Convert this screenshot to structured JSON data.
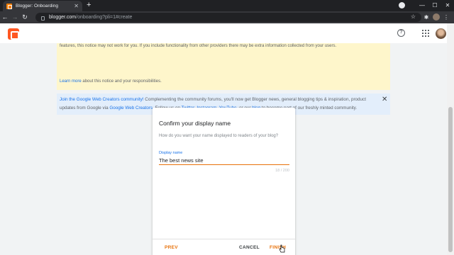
{
  "browser": {
    "tab_title": "Blogger: Onboarding",
    "tab_close": "✕",
    "new_tab": "+",
    "window_controls": [
      "—",
      "☐",
      "✕"
    ],
    "url_host": "blogger.com",
    "url_path": "/onboarding?pli=1#create",
    "nav_back": "←",
    "nav_forward": "→",
    "nav_reload": "↻",
    "bookmark_star": "☆",
    "extensions": "✱",
    "menu": "⋮"
  },
  "appbar": {
    "help": "?"
  },
  "notices": {
    "yellow_line1": "features, this notice may not work for you. If you include functionality from other providers there may be extra information collected from your users.",
    "yellow_link": "Learn more",
    "yellow_line2_rest": " about this notice and your responsibilities.",
    "blue_link1": "Join the Google Web Creators community!",
    "blue_line1_rest": " Complementing the community forums, you'll now get Blogger news, general blogging tips & inspiration, product",
    "blue_line2_a": "updates from Google via ",
    "blue_link2": "Google Web Creators",
    "blue_line2_b": ". Follow us on ",
    "blue_link3": "Twitter",
    "blue_sep1": ", ",
    "blue_link4": "Instagram",
    "blue_sep2": ", ",
    "blue_link5": "YouTube",
    "blue_line2_c": ", or our ",
    "blue_link6": "blog",
    "blue_line2_d": " to become part of our freshly minted community.",
    "close": "✕"
  },
  "dialog": {
    "title": "Confirm your display name",
    "subtitle": "How do you want your name displayed to readers of your blog?",
    "field_label": "Display name",
    "field_value": "The best news site",
    "char_count": "18 / 200",
    "prev_label": "PREV",
    "cancel_label": "CANCEL",
    "finish_label": "FINISH"
  },
  "colors": {
    "accent": "#e8710a",
    "link": "#1a73e8",
    "notice_yellow": "#fef6cb",
    "notice_blue": "#e3eefb",
    "brand": "#ff5722"
  }
}
